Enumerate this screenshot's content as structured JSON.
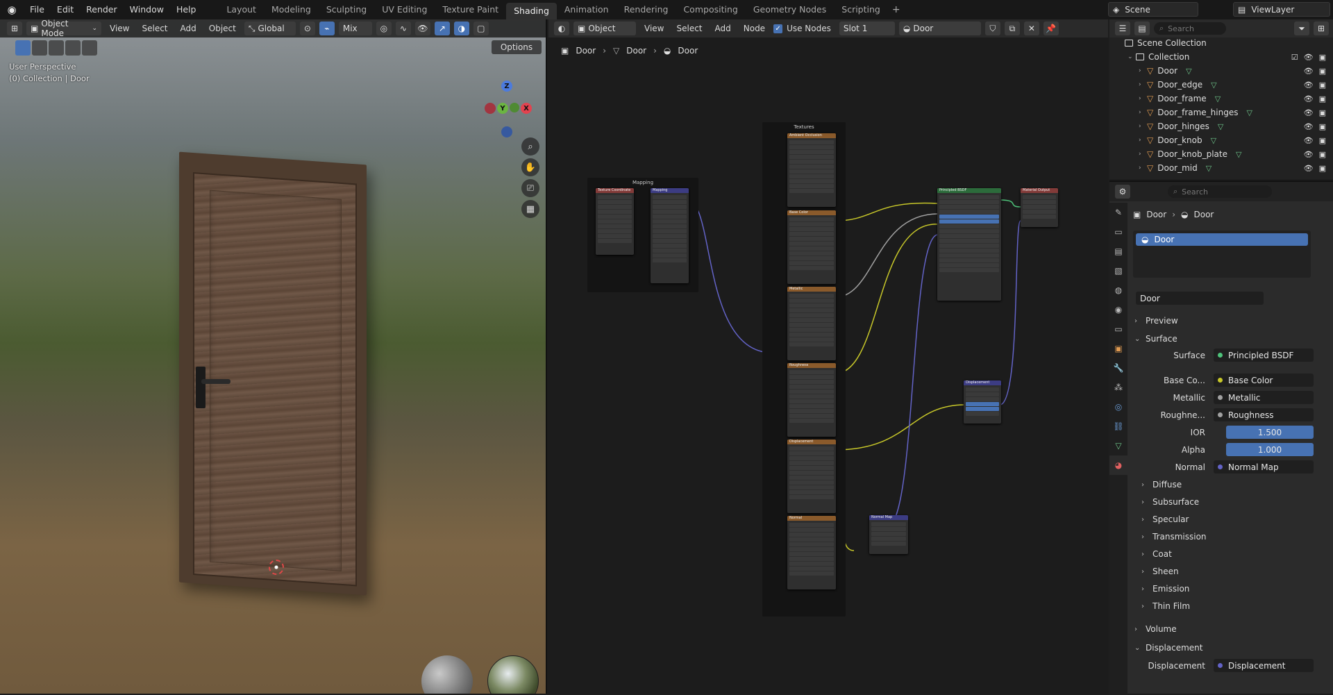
{
  "topbar": {
    "menu": [
      "File",
      "Edit",
      "Render",
      "Window",
      "Help"
    ],
    "workspaces": [
      "Layout",
      "Modeling",
      "Sculpting",
      "UV Editing",
      "Texture Paint",
      "Shading",
      "Animation",
      "Rendering",
      "Compositing",
      "Geometry Nodes",
      "Scripting"
    ],
    "active_workspace": "Shading",
    "scene": "Scene",
    "view_layer": "ViewLayer"
  },
  "viewport": {
    "mode": "Object Mode",
    "menus": [
      "View",
      "Select",
      "Add",
      "Object"
    ],
    "orientation": "Global",
    "pivot_mix": "Mix",
    "options_label": "Options",
    "perspective": "User Perspective",
    "collection_label": "(0) Collection | Door",
    "gizmo": {
      "z": "Z",
      "y": "Y",
      "x": "X"
    }
  },
  "node_editor": {
    "object_dropdown": "Object",
    "menus": [
      "View",
      "Select",
      "Add",
      "Node"
    ],
    "use_nodes_label": "Use Nodes",
    "slot": "Slot 1",
    "material": "Door",
    "breadcrumbs": [
      "Door",
      "Door",
      "Door"
    ],
    "frames": {
      "textures": "Textures",
      "mapping": "Mapping"
    },
    "nodes": {
      "tex_coord": "Texture Coordinate",
      "mapping": "Mapping",
      "ambient_occlusion": "Ambient Occlusion",
      "base_color": "Base Color",
      "metallic": "Metallic",
      "roughness": "Roughness",
      "displacement_tex": "Displacement",
      "normal_tex": "Normal",
      "principled": "Principled BSDF",
      "material_output": "Material Output",
      "displacement": "Displacement",
      "normal_map": "Normal Map"
    }
  },
  "outliner": {
    "search_placeholder": "Search",
    "root": "Scene Collection",
    "collection": "Collection",
    "objects": [
      "Door",
      "Door_edge",
      "Door_frame",
      "Door_frame_hinges",
      "Door_hinges",
      "Door_knob",
      "Door_knob_plate",
      "Door_mid"
    ]
  },
  "properties": {
    "search_placeholder": "Search",
    "breadcrumb": [
      "Door",
      "Door"
    ],
    "slot_item": "Door",
    "material_name": "Door",
    "sections": {
      "preview": "Preview",
      "surface": "Surface",
      "diffuse": "Diffuse",
      "subsurface": "Subsurface",
      "specular": "Specular",
      "transmission": "Transmission",
      "coat": "Coat",
      "sheen": "Sheen",
      "emission": "Emission",
      "thin_film": "Thin Film",
      "volume": "Volume",
      "displacement": "Displacement"
    },
    "fields": {
      "surface_label": "Surface",
      "surface_value": "Principled BSDF",
      "basecolor_label": "Base Co...",
      "basecolor_value": "Base Color",
      "metallic_label": "Metallic",
      "metallic_value": "Metallic",
      "roughness_label": "Roughne...",
      "roughness_value": "Roughness",
      "ior_label": "IOR",
      "ior_value": "1.500",
      "alpha_label": "Alpha",
      "alpha_value": "1.000",
      "normal_label": "Normal",
      "normal_value": "Normal Map",
      "displacement_label": "Displacement",
      "displacement_value": "Displacement"
    },
    "colors": {
      "accent": "#4772b3",
      "yellow_socket": "#c7c729",
      "gray_socket": "#a1a1a1",
      "violet_socket": "#6363c7",
      "green_socket": "#4ec37a"
    }
  }
}
